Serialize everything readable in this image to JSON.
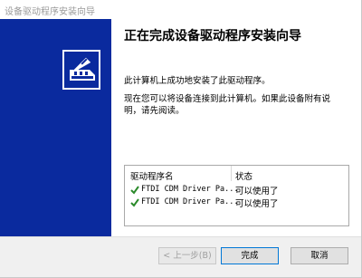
{
  "window": {
    "title": "设备驱动程序安装向导"
  },
  "heading": "正在完成设备驱动程序安装向导",
  "paragraph1": "此计算机上成功地安装了此驱动程序。",
  "paragraph2": "现在您可以将设备连接到此计算机。如果此设备附有说明，请先阅读。",
  "table": {
    "columns": [
      "驱动程序名",
      "状态"
    ],
    "rows": [
      {
        "name": "FTDI CDM Driver Pa...",
        "status": "可以使用了"
      },
      {
        "name": "FTDI CDM Driver Pa...",
        "status": "可以使用了"
      }
    ]
  },
  "buttons": {
    "back": "< 上一步(B)",
    "finish": "完成",
    "cancel": "取消"
  },
  "colors": {
    "banner": "#0a2a9e",
    "check": "#2a8a2a"
  }
}
